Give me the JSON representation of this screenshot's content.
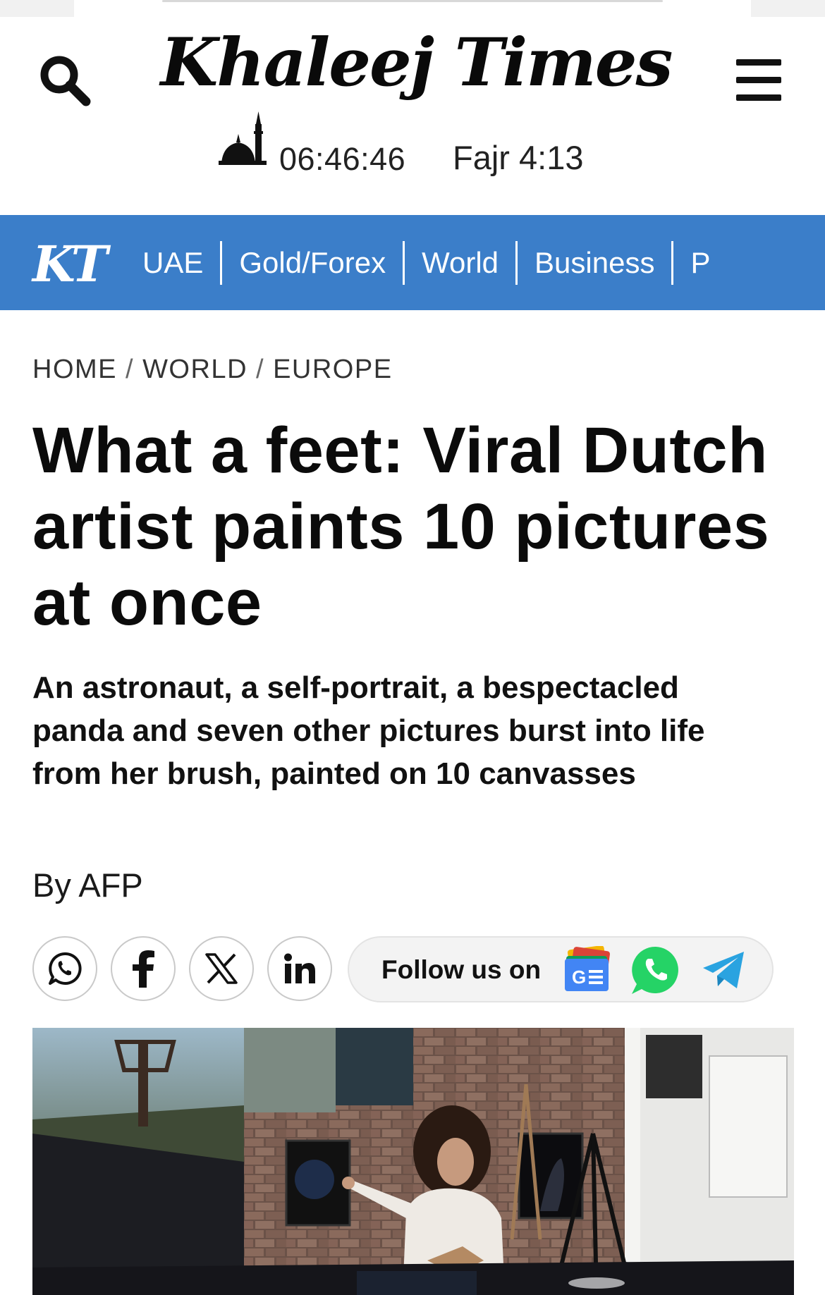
{
  "header": {
    "logo_text": "Khaleej Times",
    "prayer_clock": "06:46:46",
    "prayer_next": "Fajr 4:13"
  },
  "nav": {
    "logo_text": "KT",
    "items": [
      "UAE",
      "Gold/Forex",
      "World",
      "Business",
      "P"
    ]
  },
  "breadcrumb": [
    "HOME",
    "WORLD",
    "EUROPE"
  ],
  "breadcrumb_sep": "/",
  "article": {
    "headline": "What a feet: Viral Dutch artist paints 10 pictures at once",
    "summary": "An astronaut, a self-portrait, a bespectacled panda and seven other pictures burst into life from her brush, painted on 10 canvasses",
    "byline": "By AFP"
  },
  "share": {
    "buttons": [
      "whatsapp-icon",
      "facebook-icon",
      "x-icon",
      "linkedin-icon"
    ],
    "follow_label": "Follow us on",
    "follow_icons": [
      "google-news-icon",
      "whatsapp-icon",
      "telegram-icon"
    ]
  },
  "colors": {
    "nav_bg": "#3b7ec9",
    "whatsapp": "#25d366",
    "telegram": "#2aa3e0"
  }
}
